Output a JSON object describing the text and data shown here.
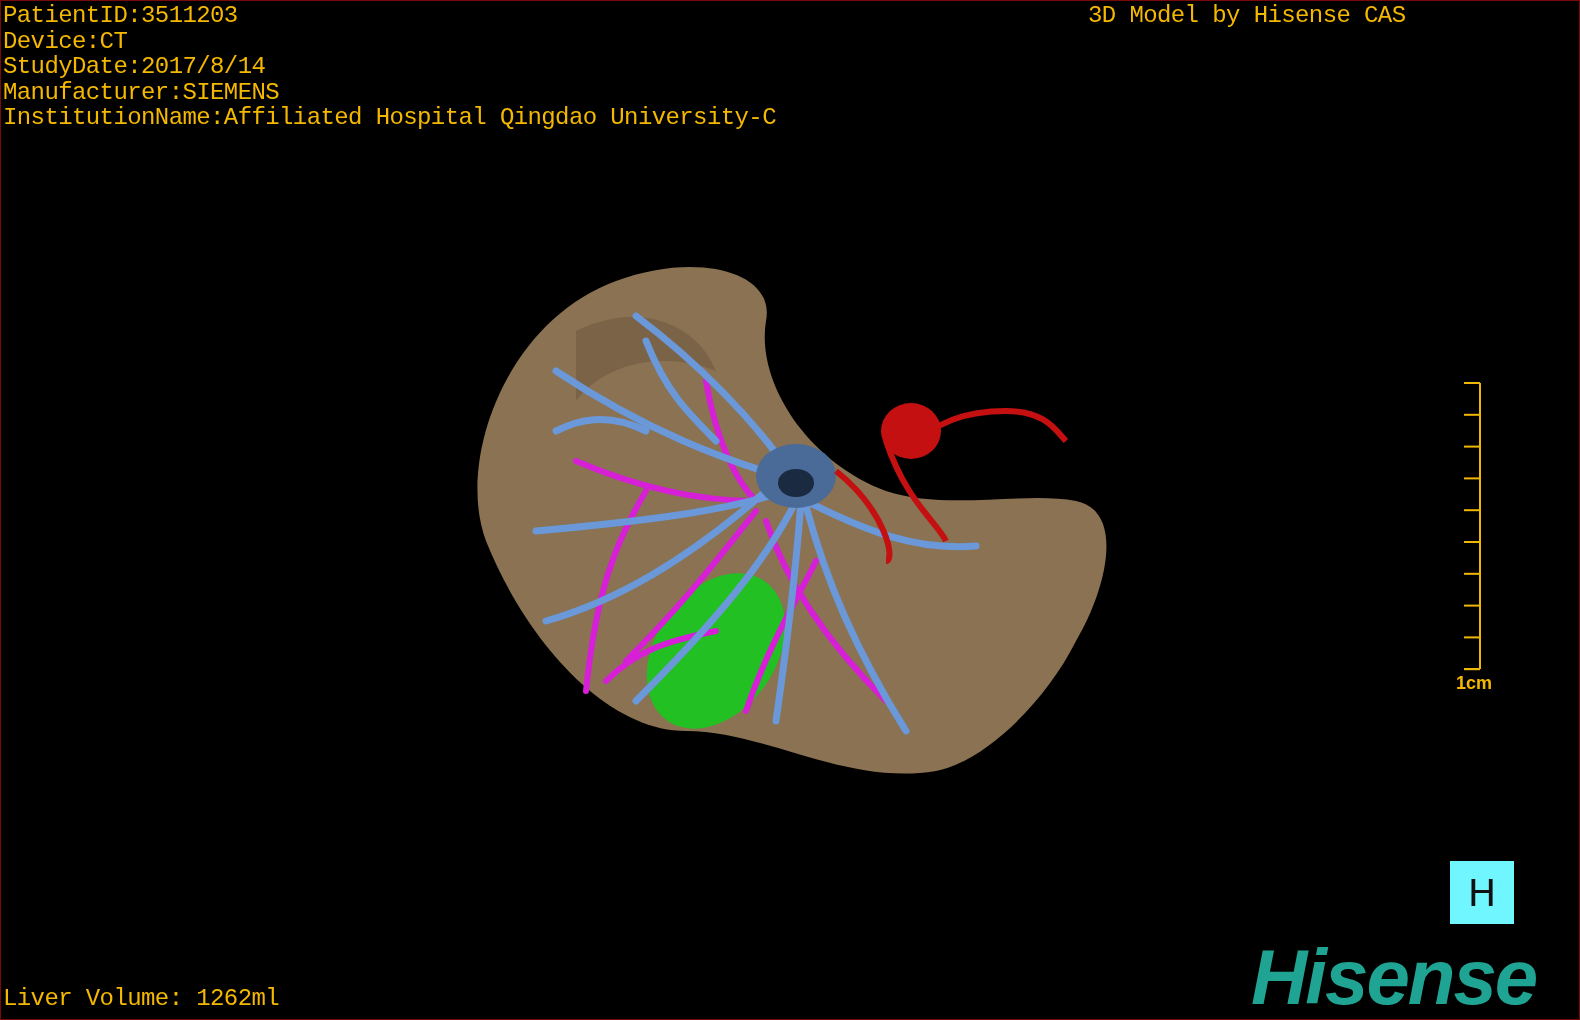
{
  "patient_info": [
    "PatientID:3511203",
    "Device:CT",
    "StudyDate:2017/8/14",
    "Manufacturer:SIEMENS",
    "InstitutionName:Affiliated Hospital Qingdao University-C"
  ],
  "model_credit": "3D Model by Hisense CAS",
  "scale_bar": {
    "label": "1cm"
  },
  "orientation_button": {
    "label": "H"
  },
  "logo": "Hisense",
  "liver_volume": "Liver Volume: 1262ml"
}
